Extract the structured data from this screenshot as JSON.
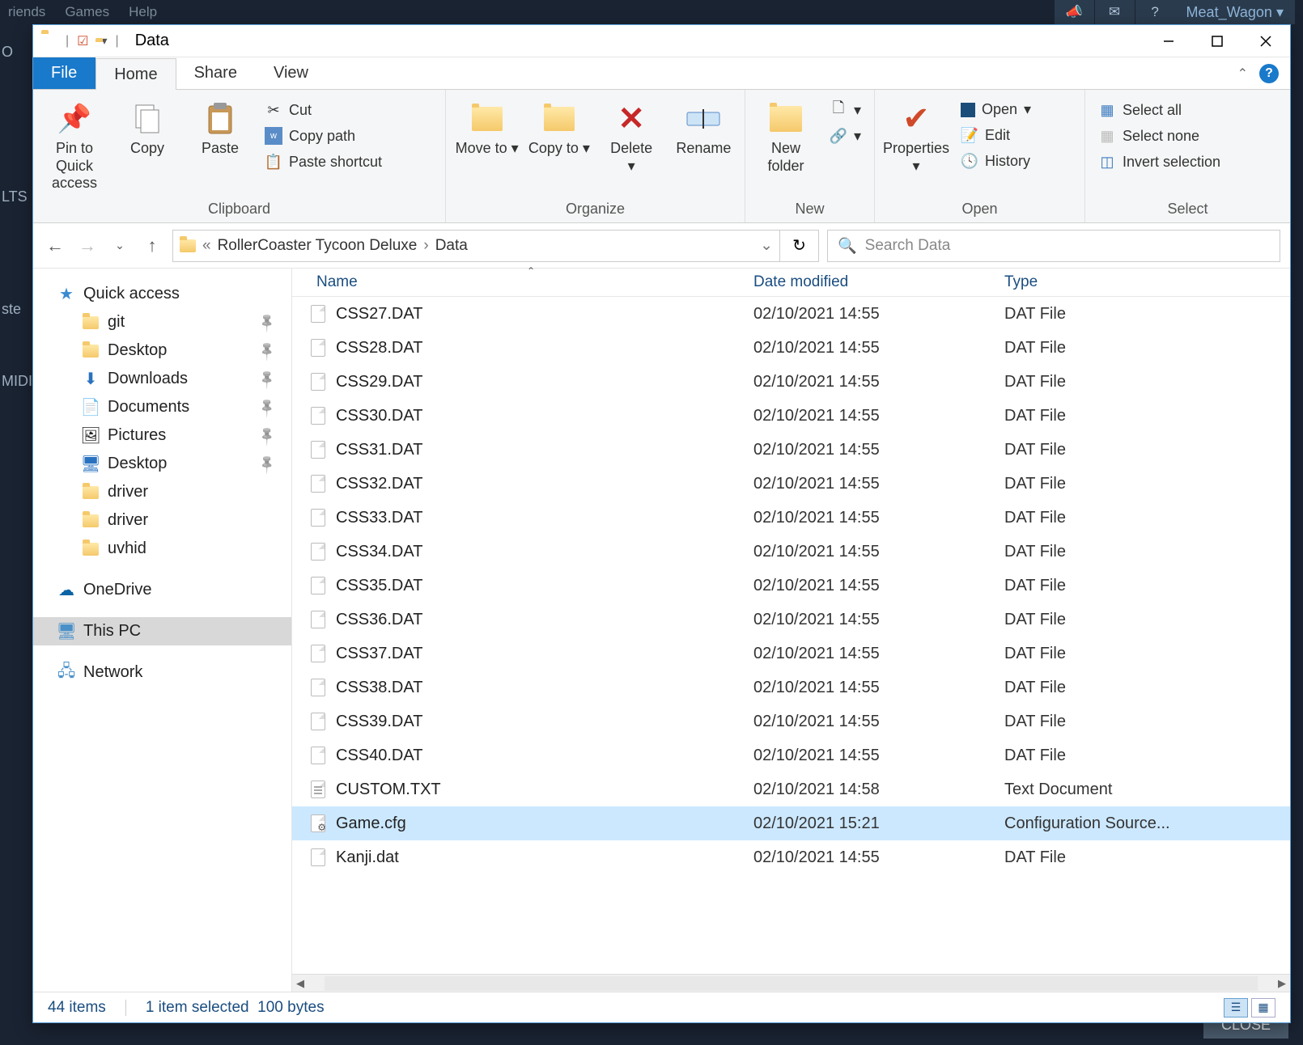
{
  "background": {
    "menus": [
      "riends",
      "Games",
      "Help"
    ],
    "user": "Meat_Wagon",
    "left_snips": [
      "O",
      "LTS",
      "ste",
      "MIDI"
    ],
    "close": "CLOSE"
  },
  "titlebar": {
    "title": "Data"
  },
  "tabs": {
    "file": "File",
    "home": "Home",
    "share": "Share",
    "view": "View"
  },
  "ribbon": {
    "clipboard": {
      "pin": "Pin to Quick access",
      "copy": "Copy",
      "paste": "Paste",
      "cut": "Cut",
      "copypath": "Copy path",
      "pasteshortcut": "Paste shortcut",
      "label": "Clipboard"
    },
    "organize": {
      "moveto": "Move to",
      "copyto": "Copy to",
      "delete": "Delete",
      "rename": "Rename",
      "label": "Organize"
    },
    "new": {
      "newfolder": "New folder",
      "label": "New"
    },
    "open": {
      "properties": "Properties",
      "open": "Open",
      "edit": "Edit",
      "history": "History",
      "label": "Open"
    },
    "select": {
      "selectall": "Select all",
      "selectnone": "Select none",
      "invert": "Invert selection",
      "label": "Select"
    }
  },
  "address": {
    "crumb1": "RollerCoaster Tycoon Deluxe",
    "crumb2": "Data",
    "search_placeholder": "Search Data"
  },
  "nav": {
    "quickaccess": "Quick access",
    "items": [
      {
        "label": "git",
        "icon": "folder",
        "pinned": true
      },
      {
        "label": "Desktop",
        "icon": "folder",
        "pinned": true
      },
      {
        "label": "Downloads",
        "icon": "download",
        "pinned": true
      },
      {
        "label": "Documents",
        "icon": "doc",
        "pinned": true
      },
      {
        "label": "Pictures",
        "icon": "pic",
        "pinned": true
      },
      {
        "label": "Desktop",
        "icon": "desktop",
        "pinned": true
      },
      {
        "label": "driver",
        "icon": "folder",
        "pinned": false
      },
      {
        "label": "driver",
        "icon": "folder",
        "pinned": false
      },
      {
        "label": "uvhid",
        "icon": "folder",
        "pinned": false
      }
    ],
    "onedrive": "OneDrive",
    "thispc": "This PC",
    "network": "Network"
  },
  "columns": {
    "name": "Name",
    "date": "Date modified",
    "type": "Type"
  },
  "files": [
    {
      "name": "CSS27.DAT",
      "date": "02/10/2021 14:55",
      "type": "DAT File",
      "icon": "file"
    },
    {
      "name": "CSS28.DAT",
      "date": "02/10/2021 14:55",
      "type": "DAT File",
      "icon": "file"
    },
    {
      "name": "CSS29.DAT",
      "date": "02/10/2021 14:55",
      "type": "DAT File",
      "icon": "file"
    },
    {
      "name": "CSS30.DAT",
      "date": "02/10/2021 14:55",
      "type": "DAT File",
      "icon": "file"
    },
    {
      "name": "CSS31.DAT",
      "date": "02/10/2021 14:55",
      "type": "DAT File",
      "icon": "file"
    },
    {
      "name": "CSS32.DAT",
      "date": "02/10/2021 14:55",
      "type": "DAT File",
      "icon": "file"
    },
    {
      "name": "CSS33.DAT",
      "date": "02/10/2021 14:55",
      "type": "DAT File",
      "icon": "file"
    },
    {
      "name": "CSS34.DAT",
      "date": "02/10/2021 14:55",
      "type": "DAT File",
      "icon": "file"
    },
    {
      "name": "CSS35.DAT",
      "date": "02/10/2021 14:55",
      "type": "DAT File",
      "icon": "file"
    },
    {
      "name": "CSS36.DAT",
      "date": "02/10/2021 14:55",
      "type": "DAT File",
      "icon": "file"
    },
    {
      "name": "CSS37.DAT",
      "date": "02/10/2021 14:55",
      "type": "DAT File",
      "icon": "file"
    },
    {
      "name": "CSS38.DAT",
      "date": "02/10/2021 14:55",
      "type": "DAT File",
      "icon": "file"
    },
    {
      "name": "CSS39.DAT",
      "date": "02/10/2021 14:55",
      "type": "DAT File",
      "icon": "file"
    },
    {
      "name": "CSS40.DAT",
      "date": "02/10/2021 14:55",
      "type": "DAT File",
      "icon": "file"
    },
    {
      "name": "CUSTOM.TXT",
      "date": "02/10/2021 14:58",
      "type": "Text Document",
      "icon": "txt"
    },
    {
      "name": "Game.cfg",
      "date": "02/10/2021 15:21",
      "type": "Configuration Source...",
      "icon": "gear",
      "selected": true
    },
    {
      "name": "Kanji.dat",
      "date": "02/10/2021 14:55",
      "type": "DAT File",
      "icon": "file"
    }
  ],
  "status": {
    "items": "44 items",
    "selected": "1 item selected",
    "size": "100 bytes"
  }
}
